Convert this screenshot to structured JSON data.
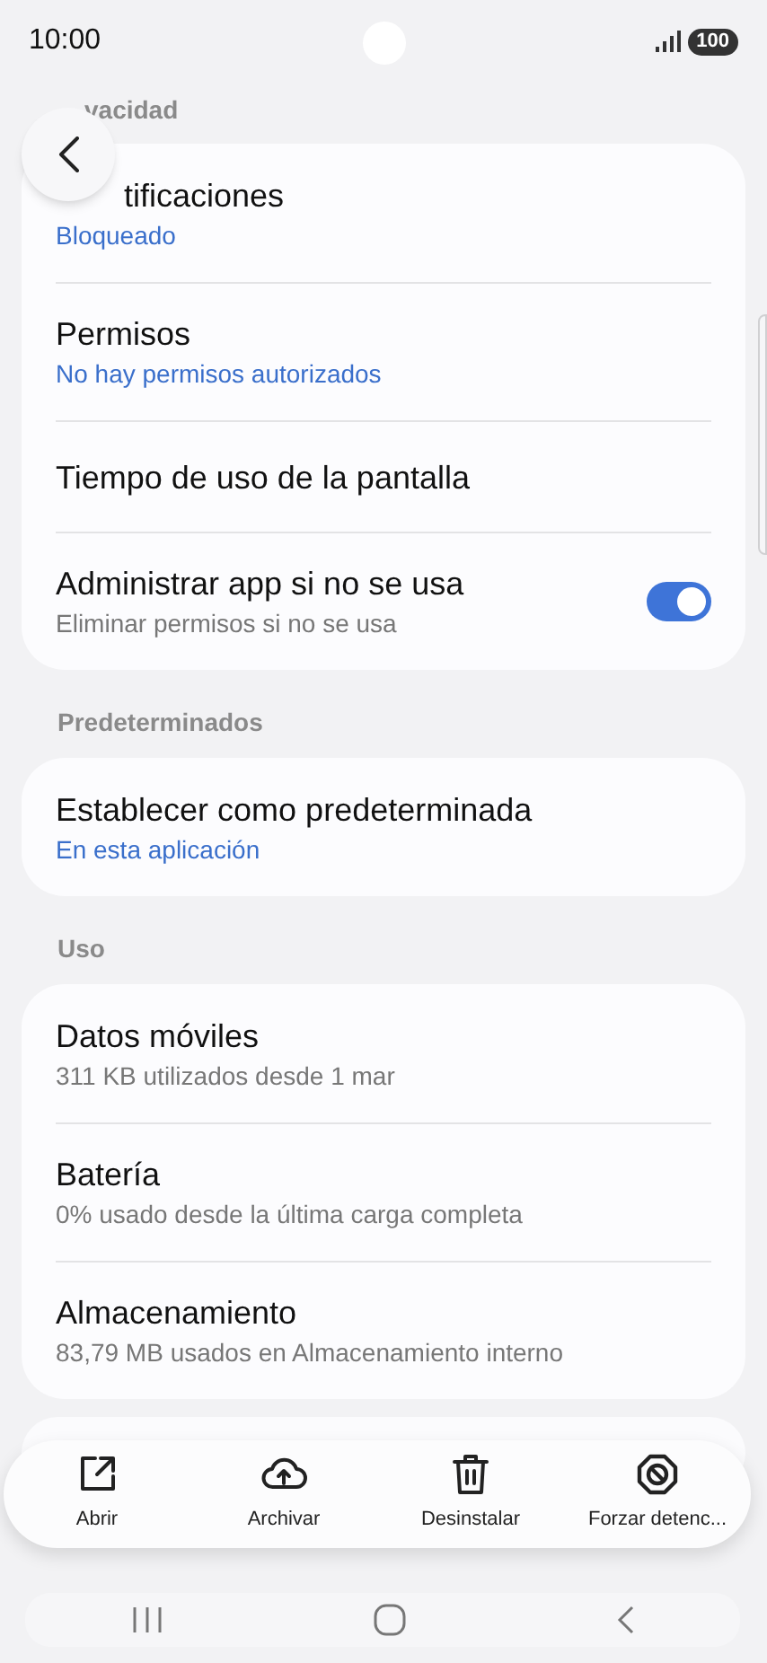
{
  "status_bar": {
    "time": "10:00",
    "battery": "100"
  },
  "sections": [
    {
      "header": "vacidad",
      "items": [
        {
          "kind": "link",
          "title": "tificaciones",
          "subtitle": "Bloqueado"
        },
        {
          "kind": "link",
          "title": "Permisos",
          "subtitle": "No hay permisos autorizados"
        },
        {
          "kind": "plain",
          "title": "Tiempo de uso de la pantalla"
        },
        {
          "kind": "toggle",
          "title": "Administrar app si no se usa",
          "subtitle": "Eliminar permisos si no se usa",
          "on": true
        }
      ]
    },
    {
      "header": "Predeterminados",
      "items": [
        {
          "kind": "link",
          "title": "Establecer como predeterminada",
          "subtitle": "En esta aplicación"
        }
      ]
    },
    {
      "header": "Uso",
      "items": [
        {
          "kind": "info",
          "title": "Datos móviles",
          "subtitle": "311 KB utilizados desde 1 mar"
        },
        {
          "kind": "info",
          "title": "Batería",
          "subtitle": "0% usado desde la última carga completa"
        },
        {
          "kind": "info",
          "title": "Almacenamiento",
          "subtitle": "83,79 MB usados en Almacenamiento interno"
        }
      ]
    }
  ],
  "actions": [
    {
      "kind": "open",
      "label": "Abrir"
    },
    {
      "kind": "upload",
      "label": "Archivar"
    },
    {
      "kind": "trash",
      "label": "Desinstalar"
    },
    {
      "kind": "block",
      "label": "Forzar detenc..."
    }
  ]
}
